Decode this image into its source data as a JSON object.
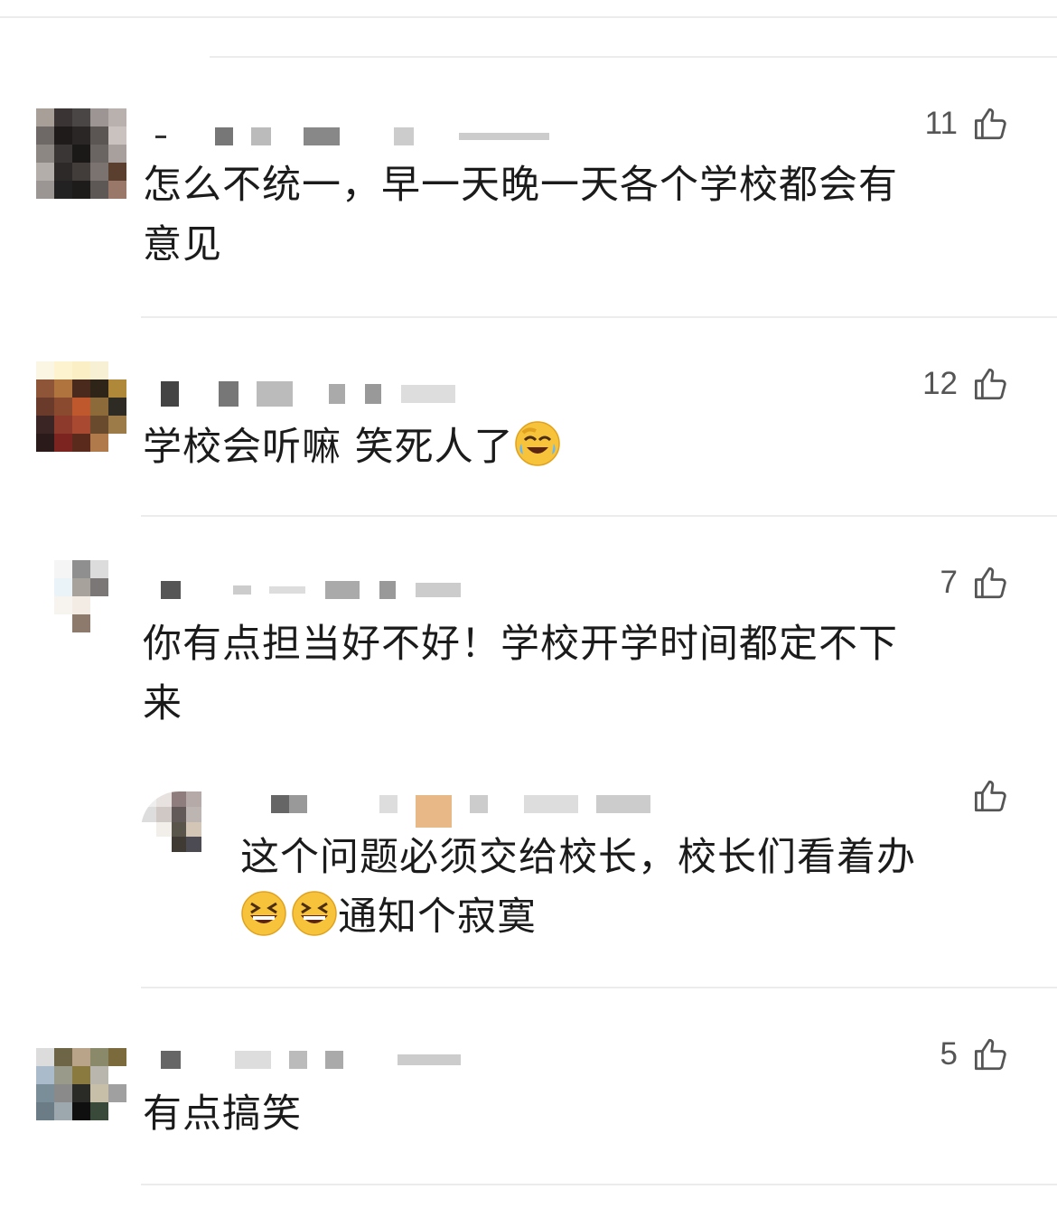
{
  "comments": [
    {
      "text_line1": "怎么不统一，早一天晚一天各个学校都会有",
      "text_line2": "意见",
      "likes": "11"
    },
    {
      "text": "学校会听嘛 笑死人了",
      "emoji": "face-with-tears-of-joy",
      "likes": "12"
    },
    {
      "text_line1": "你有点担当好不好！学校开学时间都定不下",
      "text_line2": "来",
      "likes": "7",
      "reply": {
        "text_line1": "这个问题必须交给校长，校长们看着办",
        "text_line2_suffix": "通知个寂寞",
        "emoji": "grinning-squinting-face"
      }
    },
    {
      "text": "有点搞笑",
      "likes": "5"
    }
  ],
  "colors": {
    "divider": "#ececec",
    "text": "#1b1b1b",
    "icon": "#555555"
  }
}
